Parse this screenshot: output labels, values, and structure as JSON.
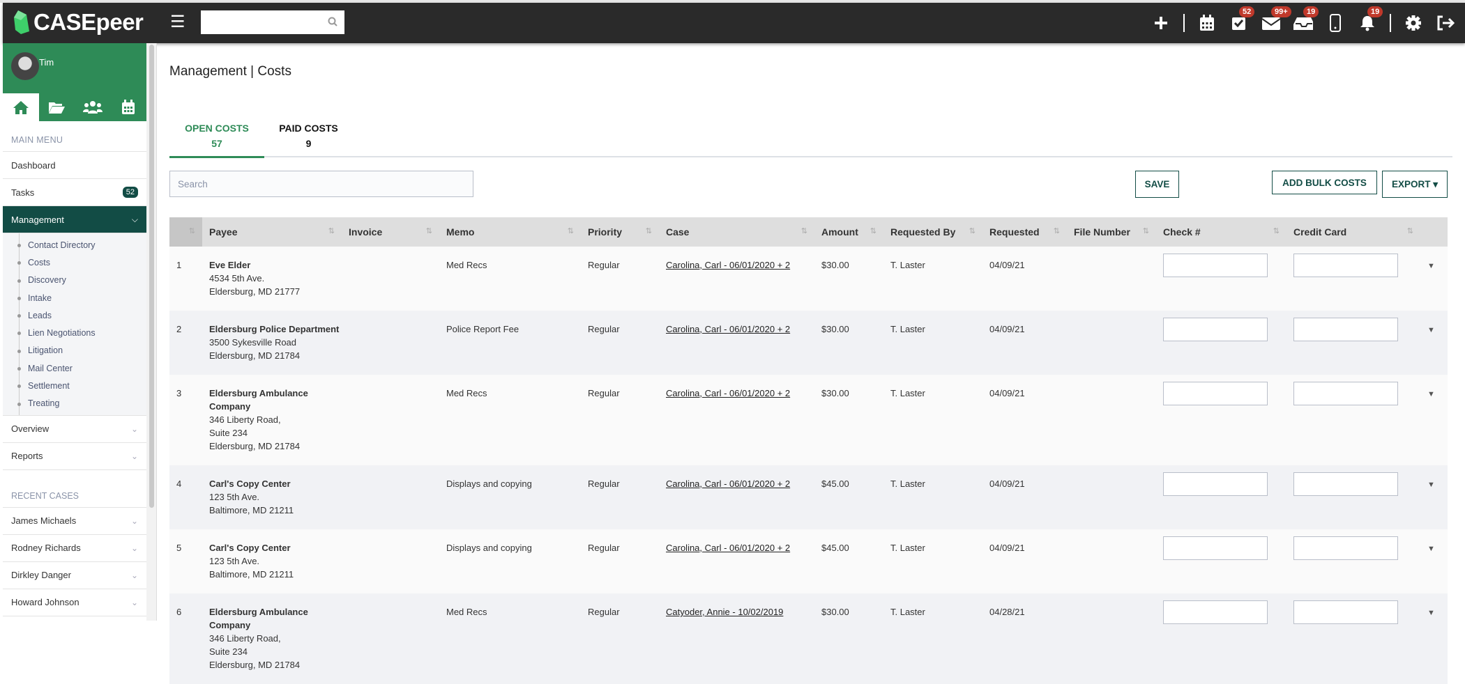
{
  "header": {
    "logo": "CASEpeer",
    "search_placeholder": "",
    "badges": {
      "tasks": "52",
      "mail": "99+",
      "inbox": "19",
      "notifications": "19"
    }
  },
  "sidebar": {
    "user": "Tim",
    "main_menu_label": "MAIN MENU",
    "items": [
      {
        "label": "Dashboard"
      },
      {
        "label": "Tasks",
        "badge": "52"
      },
      {
        "label": "Management"
      }
    ],
    "submenu": [
      "Contact Directory",
      "Costs",
      "Discovery",
      "Intake",
      "Leads",
      "Lien Negotiations",
      "Litigation",
      "Mail Center",
      "Settlement",
      "Treating"
    ],
    "more": [
      "Overview",
      "Reports"
    ],
    "recent_label": "RECENT CASES",
    "recent": [
      "James Michaels",
      "Rodney Richards",
      "Dirkley Danger",
      "Howard Johnson"
    ]
  },
  "page": {
    "title": "Management | Costs",
    "tabs": [
      {
        "label": "OPEN COSTS",
        "count": "57"
      },
      {
        "label": "PAID COSTS",
        "count": "9"
      }
    ],
    "search_placeholder": "Search",
    "save": "SAVE",
    "add_bulk": "ADD BULK COSTS",
    "export": "EXPORT ▾"
  },
  "table": {
    "columns": [
      "",
      "Payee",
      "Invoice",
      "Memo",
      "Priority",
      "Case",
      "Amount",
      "Requested By",
      "Requested",
      "File Number",
      "Check #",
      "Credit Card",
      ""
    ],
    "rows": [
      {
        "n": "1",
        "payee": "Eve Elder",
        "addr": [
          "4534 5th Ave.",
          "Eldersburg, MD 21777"
        ],
        "invoice": "",
        "memo": "Med Recs",
        "priority": "Regular",
        "case": "Carolina, Carl - 06/01/2020 + 2",
        "amount": "$30.00",
        "by": "T. Laster",
        "requested": "04/09/21",
        "file": "",
        "check": "",
        "card": ""
      },
      {
        "n": "2",
        "payee": "Eldersburg Police Department",
        "addr": [
          "3500 Sykesville Road",
          "Eldersburg, MD 21784"
        ],
        "invoice": "",
        "memo": "Police Report Fee",
        "priority": "Regular",
        "case": "Carolina, Carl - 06/01/2020 + 2",
        "amount": "$30.00",
        "by": "T. Laster",
        "requested": "04/09/21",
        "file": "",
        "check": "",
        "card": ""
      },
      {
        "n": "3",
        "payee": "Eldersburg Ambulance Company",
        "addr": [
          "346 Liberty Road,",
          "Suite 234",
          "Eldersburg, MD 21784"
        ],
        "invoice": "",
        "memo": "Med Recs",
        "priority": "Regular",
        "case": "Carolina, Carl - 06/01/2020 + 2",
        "amount": "$30.00",
        "by": "T. Laster",
        "requested": "04/09/21",
        "file": "",
        "check": "",
        "card": ""
      },
      {
        "n": "4",
        "payee": "Carl's Copy Center",
        "addr": [
          "123 5th Ave.",
          "Baltimore, MD 21211"
        ],
        "invoice": "",
        "memo": "Displays and copying",
        "priority": "Regular",
        "case": "Carolina, Carl - 06/01/2020 + 2",
        "amount": "$45.00",
        "by": "T. Laster",
        "requested": "04/09/21",
        "file": "",
        "check": "",
        "card": ""
      },
      {
        "n": "5",
        "payee": "Carl's Copy Center",
        "addr": [
          "123 5th Ave.",
          "Baltimore, MD 21211"
        ],
        "invoice": "",
        "memo": "Displays and copying",
        "priority": "Regular",
        "case": "Carolina, Carl - 06/01/2020 + 2",
        "amount": "$45.00",
        "by": "T. Laster",
        "requested": "04/09/21",
        "file": "",
        "check": "",
        "card": ""
      },
      {
        "n": "6",
        "payee": "Eldersburg Ambulance Company",
        "addr": [
          "346 Liberty Road,",
          "Suite 234",
          "Eldersburg, MD 21784"
        ],
        "invoice": "",
        "memo": "Med Recs",
        "priority": "Regular",
        "case": "Catyoder, Annie - 10/02/2019",
        "amount": "$30.00",
        "by": "T. Laster",
        "requested": "04/28/21",
        "file": "",
        "check": "",
        "card": ""
      }
    ]
  }
}
